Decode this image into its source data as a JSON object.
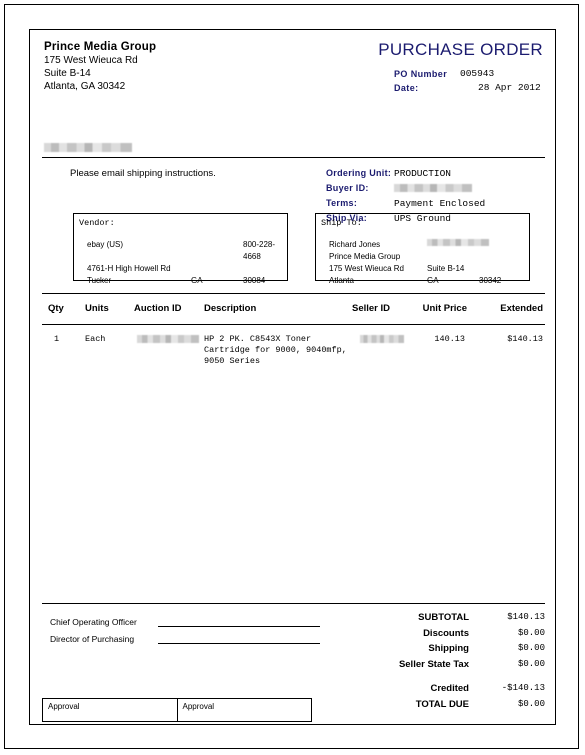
{
  "document": {
    "title": "PURCHASE ORDER",
    "accent_color": "#1b1b6f"
  },
  "company": {
    "name": "Prince Media Group",
    "address_line1": "175 West Wieuca Rd",
    "address_line2": "Suite B-14",
    "address_line3": "Atlanta, GA 30342"
  },
  "po_meta": {
    "po_number_label": "PO Number",
    "po_number": "005943",
    "date_label": "Date:",
    "date": "28 Apr 2012"
  },
  "notice": {
    "shipping_note": "Please email shipping instructions."
  },
  "ordering": {
    "unit_label": "Ordering Unit:",
    "unit_value": "PRODUCTION",
    "buyer_label": "Buyer ID:",
    "buyer_value": "",
    "terms_label": "Terms:",
    "terms_value": "Payment Enclosed",
    "ship_via_label": "Ship Via:",
    "ship_via_value": "UPS Ground"
  },
  "vendor": {
    "title": "Vendor:",
    "name": "ebay (US)",
    "phone": "800-228-4668",
    "street": "4761-H High Howell Rd",
    "city": "Tucker",
    "state": "GA",
    "zip": "30084"
  },
  "ship_to": {
    "title": "Ship To:",
    "contact": "Richard Jones",
    "phone": "",
    "company": "Prince Media Group",
    "street": "175 West Wieuca Rd",
    "suite": "Suite B-14",
    "city": "Atlanta",
    "state": "GA",
    "zip": "30342"
  },
  "items_table": {
    "columns": {
      "qty": "Qty",
      "units": "Units",
      "auction_id": "Auction ID",
      "description": "Description",
      "seller_id": "Seller ID",
      "unit_price": "Unit Price",
      "extended": "Extended"
    },
    "rows": [
      {
        "qty": "1",
        "units": "Each",
        "auction_id": "",
        "description": "HP 2 PK. C8543X Toner\nCartridge for 9000, 9040mfp,\n9050 Series",
        "seller_id": "",
        "unit_price": "140.13",
        "extended": "$140.13"
      }
    ]
  },
  "signatures": {
    "coo_label": "Chief Operating Officer",
    "purchasing_label": "Director of Purchasing",
    "approval_left": "Approval",
    "approval_right": "Approval"
  },
  "totals": {
    "subtotal_label": "SUBTOTAL",
    "subtotal_value": "$140.13",
    "discounts_label": "Discounts",
    "discounts_value": "$0.00",
    "shipping_label": "Shipping",
    "shipping_value": "$0.00",
    "tax_label": "Seller State Tax",
    "tax_value": "$0.00",
    "credited_label": "Credited",
    "credited_value": "-$140.13",
    "total_due_label": "TOTAL DUE",
    "total_due_value": "$0.00"
  }
}
